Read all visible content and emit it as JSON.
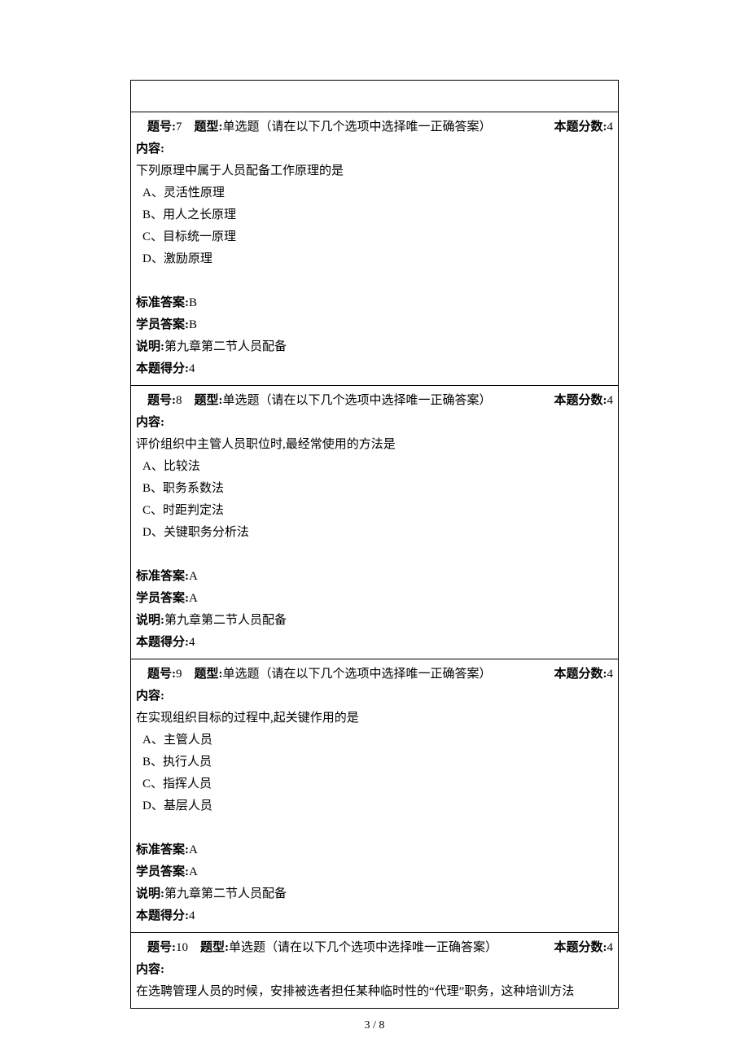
{
  "labels": {
    "qnum": "题号:",
    "qtype": "题型:",
    "qscore": "本题分数:",
    "content": "内容:",
    "std_ans": "标准答案:",
    "stu_ans": "学员答案:",
    "note": "说明:",
    "earned": "本题得分:"
  },
  "questions": [
    {
      "num": "7",
      "type": "单选题（请在以下几个选项中选择唯一正确答案）",
      "score": "4",
      "stem": "下列原理中属于人员配备工作原理的是",
      "options": [
        "A、灵活性原理",
        "B、用人之长原理",
        "C、目标统一原理",
        "D、激励原理"
      ],
      "std": "B",
      "stu": "B",
      "note": "第九章第二节人员配备",
      "earned": "4"
    },
    {
      "num": "8",
      "type": "单选题（请在以下几个选项中选择唯一正确答案）",
      "score": "4",
      "stem": "评价组织中主管人员职位时,最经常使用的方法是",
      "options": [
        "A、比较法",
        "B、职务系数法",
        "C、时距判定法",
        "D、关键职务分析法"
      ],
      "std": "A",
      "stu": "A",
      "note": "第九章第二节人员配备",
      "earned": "4"
    },
    {
      "num": "9",
      "type": "单选题（请在以下几个选项中选择唯一正确答案）",
      "score": "4",
      "stem": "在实现组织目标的过程中,起关键作用的是",
      "options": [
        "A、主管人员",
        "B、执行人员",
        "C、指挥人员",
        "D、基层人员"
      ],
      "std": "A",
      "stu": "A",
      "note": "第九章第二节人员配备",
      "earned": "4"
    },
    {
      "num": "10",
      "type": "单选题（请在以下几个选项中选择唯一正确答案）",
      "score": "4",
      "stem": "在选聘管理人员的时候，安排被选者担任某种临时性的“代理”职务，这种培训方法",
      "options": [],
      "std": "",
      "stu": "",
      "note": "",
      "earned": ""
    }
  ],
  "pagenum": "3 / 8"
}
